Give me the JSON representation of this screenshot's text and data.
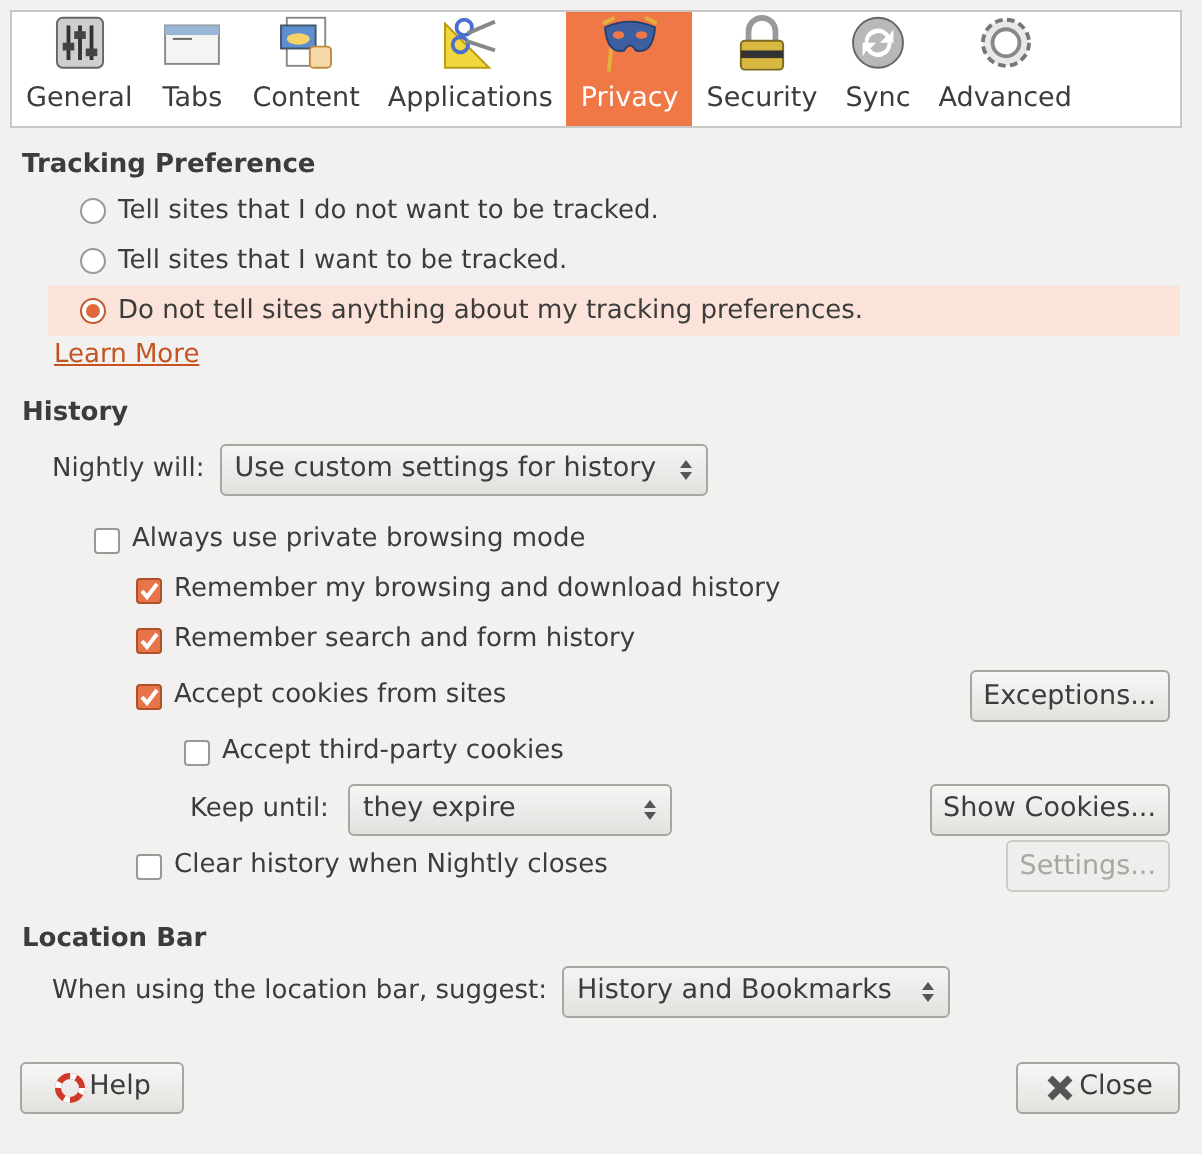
{
  "toolbar": [
    {
      "label": "General",
      "selected": false
    },
    {
      "label": "Tabs",
      "selected": false
    },
    {
      "label": "Content",
      "selected": false
    },
    {
      "label": "Applications",
      "selected": false
    },
    {
      "label": "Privacy",
      "selected": true
    },
    {
      "label": "Security",
      "selected": false
    },
    {
      "label": "Sync",
      "selected": false
    },
    {
      "label": "Advanced",
      "selected": false
    }
  ],
  "tracking": {
    "heading": "Tracking Preference",
    "options": [
      {
        "label": "Tell sites that I do not want to be tracked.",
        "selected": false,
        "hovered": false
      },
      {
        "label": "Tell sites that I want to be tracked.",
        "selected": false,
        "hovered": false
      },
      {
        "label": "Do not tell sites anything about my tracking preferences.",
        "selected": true,
        "hovered": true
      }
    ],
    "learn_more": "Learn More"
  },
  "history": {
    "heading": "History",
    "mode_label": "Nightly will:",
    "mode_value": "Use custom settings for history",
    "items": [
      {
        "kind": "checkbox",
        "label": "Always use private browsing mode",
        "checked": false,
        "children": [
          {
            "kind": "checkbox",
            "label": "Remember my browsing and download history",
            "checked": true
          },
          {
            "kind": "checkbox",
            "label": "Remember search and form history",
            "checked": true
          },
          {
            "kind": "checkbox",
            "label": "Accept cookies from sites",
            "checked": true,
            "button": {
              "label": "Exceptions...",
              "disabled": false
            },
            "children": [
              {
                "kind": "checkbox",
                "label": "Accept third-party cookies",
                "checked": false
              },
              {
                "kind": "select",
                "label": "Keep until:",
                "value": "they expire",
                "button": {
                  "label": "Show Cookies...",
                  "disabled": false
                }
              }
            ]
          },
          {
            "kind": "checkbox",
            "label": "Clear history when Nightly closes",
            "checked": false,
            "button": {
              "label": "Settings...",
              "disabled": true
            }
          }
        ]
      }
    ]
  },
  "location_bar": {
    "heading": "Location Bar",
    "label": "When using the location bar, suggest:",
    "value": "History and Bookmarks"
  },
  "buttons": {
    "help": "Help",
    "close": "Close"
  }
}
